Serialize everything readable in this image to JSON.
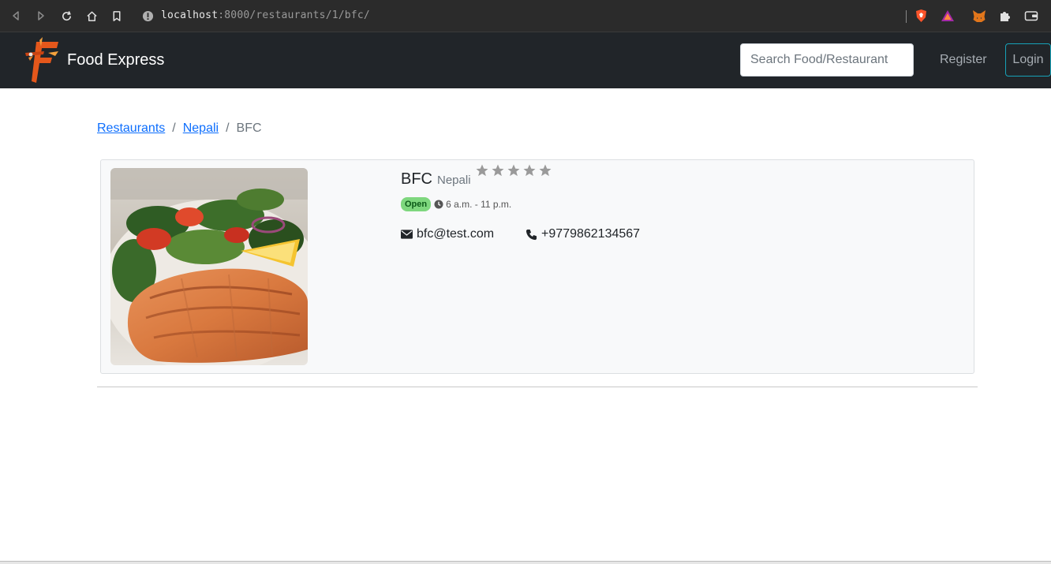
{
  "browser": {
    "url_host": "localhost",
    "url_rest": ":8000/restaurants/1/bfc/"
  },
  "navbar": {
    "brand": "Food Express",
    "search_placeholder": "Search Food/Restaurant",
    "register_label": "Register",
    "login_label": "Login"
  },
  "breadcrumb": {
    "items": [
      "Restaurants",
      "Nepali"
    ],
    "current": "BFC",
    "separator": "/"
  },
  "restaurant": {
    "name": "BFC",
    "cuisine": "Nepali",
    "rating_stars_total": 5,
    "rating_filled": 0,
    "status": "Open",
    "hours": "6 a.m. - 11 p.m.",
    "email": "bfc@test.com",
    "phone": "+9779862134567"
  },
  "colors": {
    "navbar_bg": "#212529",
    "link": "#0d6efd",
    "badge_open": "#7ed77e",
    "login_border": "#17a2b8"
  }
}
